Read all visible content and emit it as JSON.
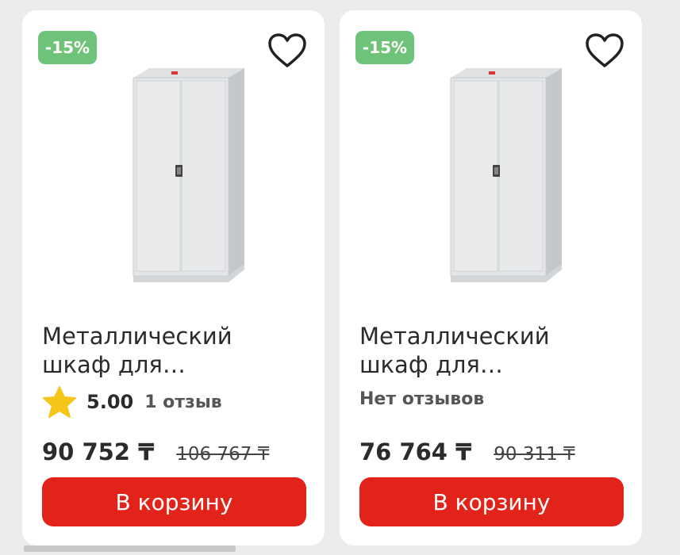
{
  "products": [
    {
      "discount": "-15%",
      "title_line1": "Металлический",
      "title_line2": "шкаф для…",
      "rating": "5.00",
      "reviews": "1 отзыв",
      "price": "90 752 ₸",
      "old_price": "106 767 ₸",
      "cart_label": "В корзину",
      "icons": {
        "favorite": "heart-outline-icon",
        "rating": "star-icon"
      }
    },
    {
      "discount": "-15%",
      "title_line1": "Металлический",
      "title_line2": "шкаф для…",
      "reviews": "Нет отзывов",
      "price": "76 764 ₸",
      "old_price": "90 311 ₸",
      "cart_label": "В корзину",
      "icons": {
        "favorite": "heart-outline-icon"
      }
    }
  ],
  "colors": {
    "accent": "#e2231a",
    "discount_badge": "#6fc27a",
    "star": "#f5c518",
    "background": "#ececef"
  }
}
